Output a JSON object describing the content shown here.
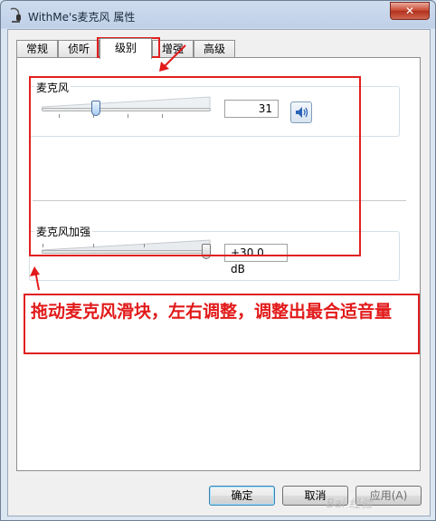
{
  "window": {
    "title": "WithMe's麦克风 属性",
    "close_label": "✕"
  },
  "tabs": [
    {
      "label": "常规"
    },
    {
      "label": "侦听"
    },
    {
      "label": "级别"
    },
    {
      "label": "增强"
    },
    {
      "label": "高级"
    }
  ],
  "active_tab": "级别",
  "microphone": {
    "label": "麦克风",
    "value": "31",
    "level_fraction": 0.31
  },
  "boost": {
    "label": "麦克风加强",
    "value": "+30.0 dB",
    "level_fraction": 1.0
  },
  "annotation": {
    "text": "拖动麦克风滑块，左右调整，调整出最合适音量",
    "color": "#e21a1a"
  },
  "buttons": {
    "ok": "确定",
    "cancel": "取消",
    "apply": "应用(A)"
  },
  "icons": {
    "speaker": "speaker-icon",
    "app": "microphone-app-icon"
  }
}
